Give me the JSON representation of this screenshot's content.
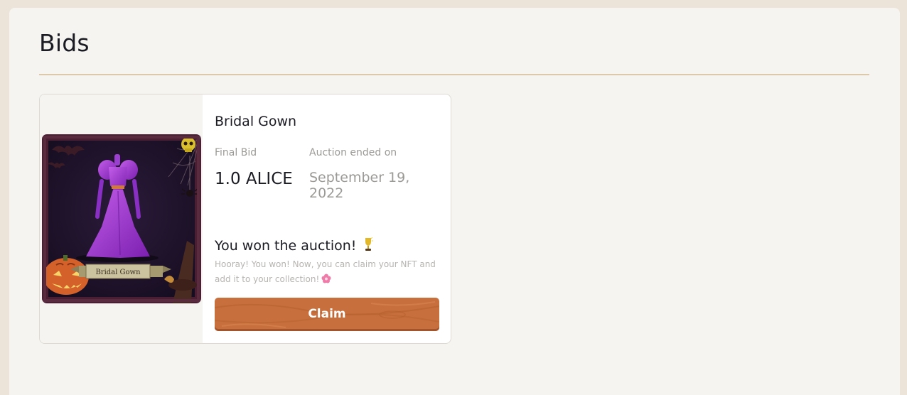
{
  "page": {
    "title": "Bids"
  },
  "bids": [
    {
      "item_name": "Bridal Gown",
      "image_label": "Bridal Gown",
      "image_icon": "halloween-gown-artwork",
      "final_bid_label": "Final Bid",
      "final_bid_value": "1.0 ALICE",
      "ended_label": "Auction ended on",
      "ended_value": "September 19, 2022",
      "status_title": "You won the auction!",
      "status_icon": "trophy-icon",
      "status_text": "Hooray! You won! Now, you can claim your NFT and add it to your collection!",
      "status_text_icon": "flower-icon",
      "claim_label": "Claim"
    }
  ],
  "colors": {
    "page_background": "#ece4d8",
    "panel_background": "#f6f4f0",
    "divider": "#dcc9ab",
    "claim_button": "#c8703d",
    "text_primary": "#1b1b24",
    "text_muted": "#9c9a96"
  }
}
